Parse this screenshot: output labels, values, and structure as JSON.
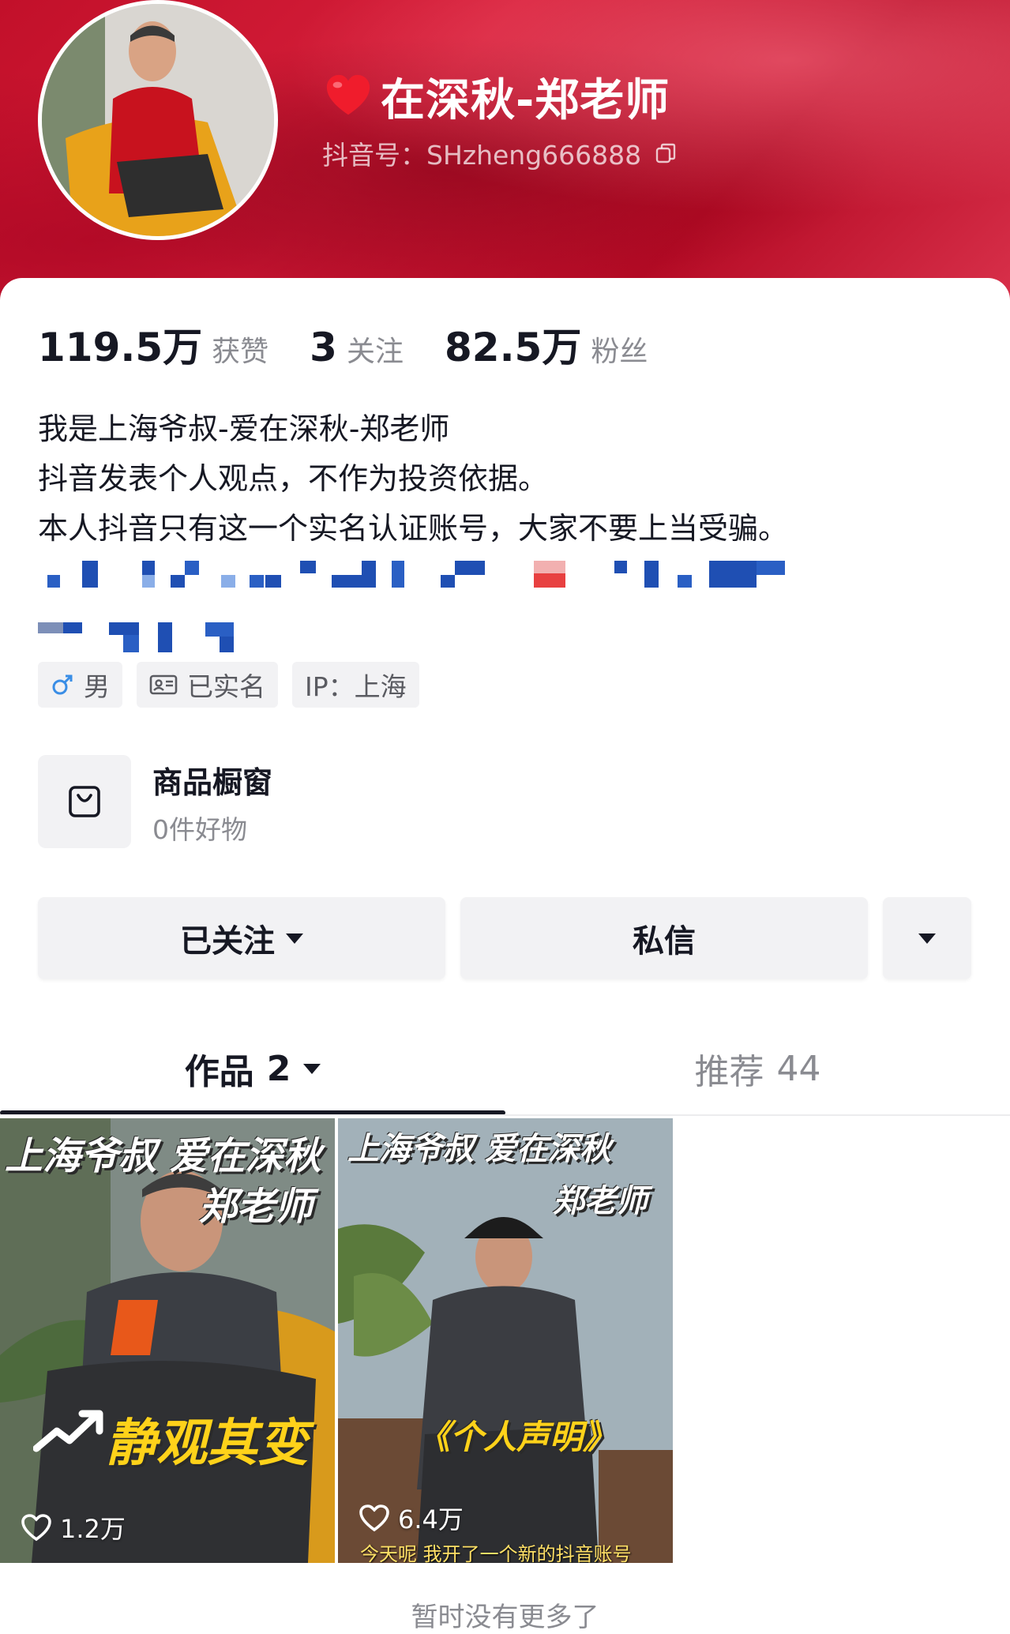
{
  "profile": {
    "nickname": "在深秋-郑老师",
    "douyin_id": "抖音号：SHzheng666888"
  },
  "stats": {
    "likes": {
      "value": "119.5万",
      "label": "获赞"
    },
    "following": {
      "value": "3",
      "label": "关注"
    },
    "followers": {
      "value": "82.5万",
      "label": "粉丝"
    }
  },
  "bio": [
    "我是上海爷叔-爱在深秋-郑老师",
    "抖音发表个人观点，不作为投资依据。",
    "本人抖音只有这一个实名认证账号，大家不要上当受骗。"
  ],
  "tags": {
    "gender": "男",
    "verified": "已实名",
    "ip": "IP：上海"
  },
  "shop": {
    "title": "商品橱窗",
    "subtitle": "0件好物"
  },
  "actions": {
    "follow": "已关注",
    "message": "私信"
  },
  "tabs": {
    "works_label": "作品",
    "works_count": "2",
    "recommend_label": "推荐",
    "recommend_count": "44"
  },
  "videos": [
    {
      "title_line1": "上海爷叔 爱在深秋",
      "title_line2": "郑老师",
      "caption": "静观其变",
      "likes": "1.2万"
    },
    {
      "title_line1": "上海爷叔 爱在深秋",
      "title_line2": "郑老师",
      "caption": "《个人声明》",
      "subtitle": "今天呢 我开了一个新的抖音账号",
      "likes": "6.4万"
    }
  ],
  "footer": {
    "no_more": "暂时没有更多了"
  },
  "colors": {
    "header_red": "#c2102a",
    "text_primary": "#161823",
    "text_secondary": "#8a8b91",
    "chip_bg": "#f2f2f4",
    "cover_yellow": "#ffd21a"
  },
  "icons": [
    "heart-emoji-icon",
    "copy-icon",
    "male-icon",
    "id-card-icon",
    "shopping-bag-icon",
    "caret-down-icon",
    "heart-outline-icon",
    "trend-arrow-icon"
  ]
}
